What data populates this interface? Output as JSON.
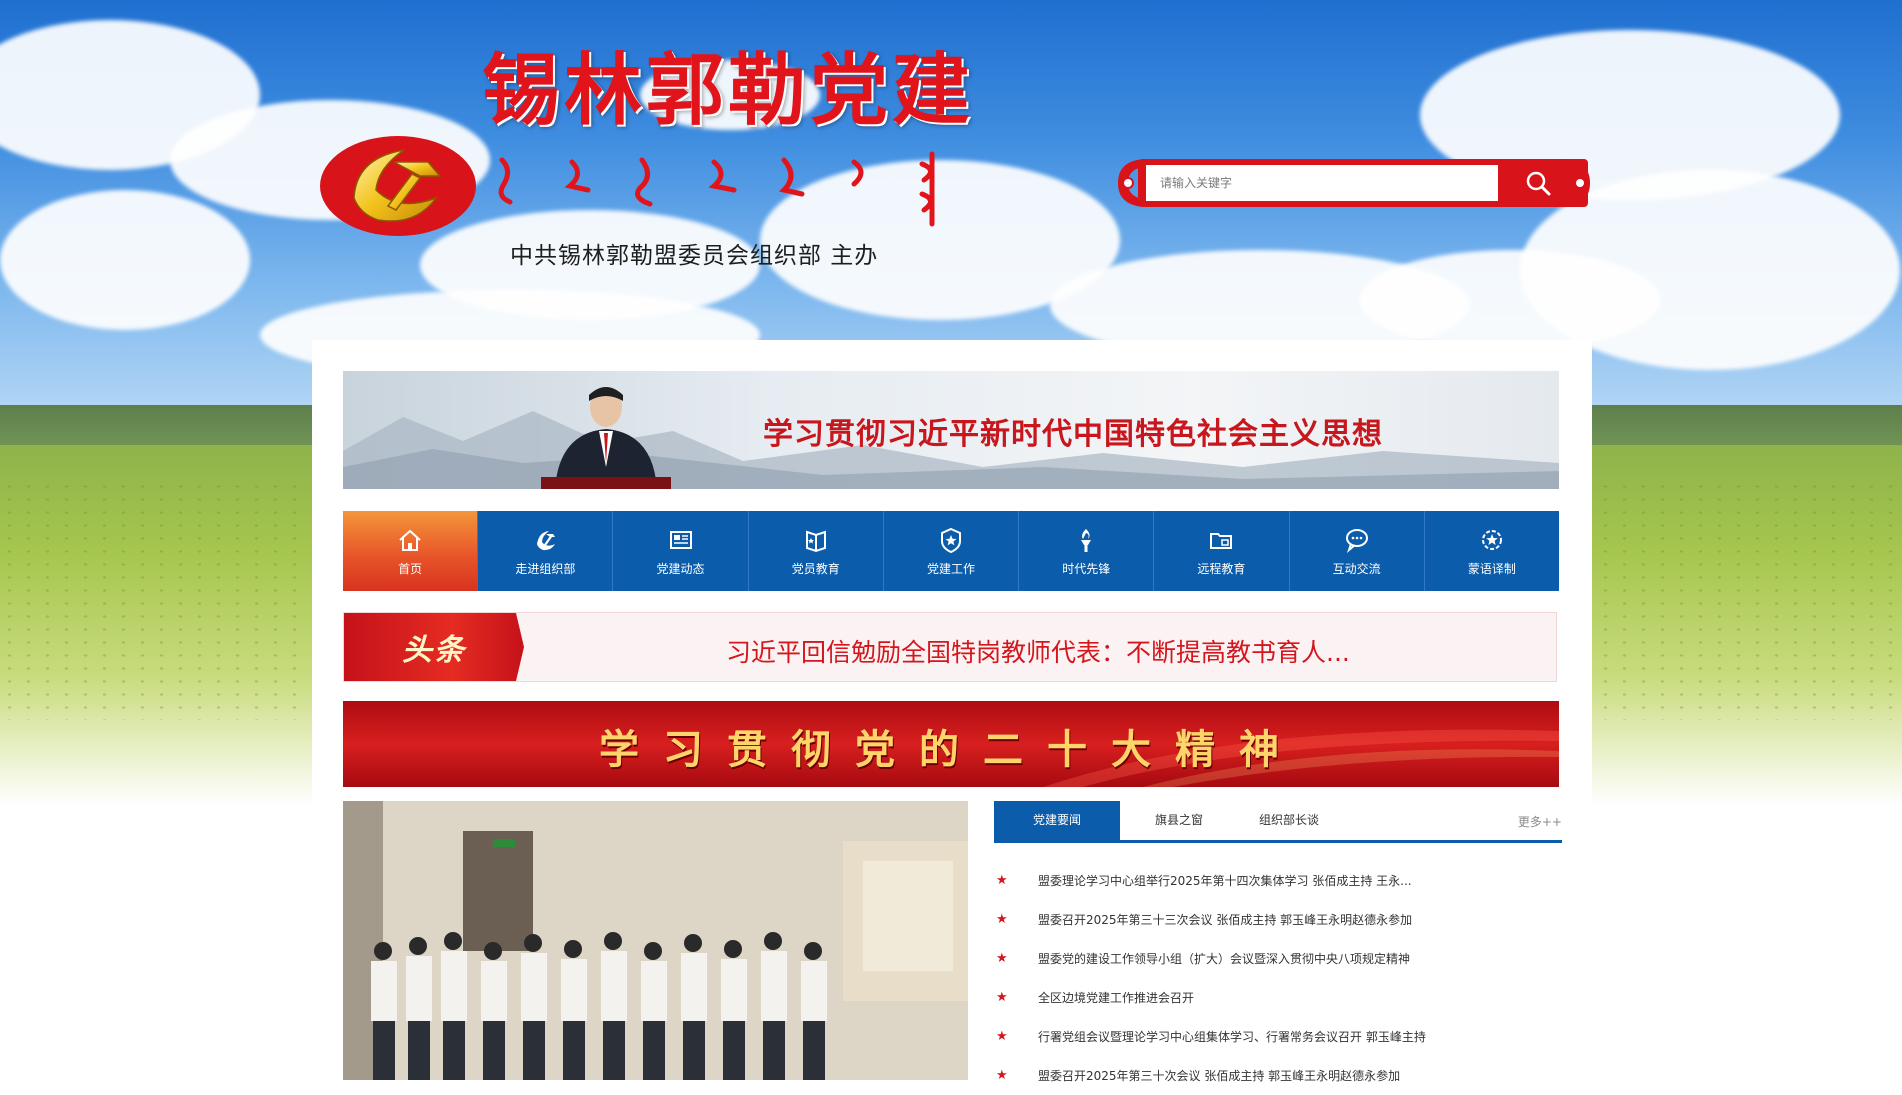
{
  "header": {
    "site_title": "锡林郭勒党建",
    "sponsor": "中共锡林郭勒盟委员会组织部 主办",
    "mongolian_script_label": "Mongolian script title"
  },
  "search": {
    "placeholder": "请输入关键字",
    "button_icon": "search-icon"
  },
  "banner": {
    "text": "学习贯彻习近平新时代中国特色社会主义思想"
  },
  "nav": {
    "items": [
      {
        "label": "首页",
        "icon": "home-icon"
      },
      {
        "label": "走进组织部",
        "icon": "party-emblem-icon"
      },
      {
        "label": "党建动态",
        "icon": "news-icon"
      },
      {
        "label": "党员教育",
        "icon": "book-icon"
      },
      {
        "label": "党建工作",
        "icon": "badge-star-icon"
      },
      {
        "label": "时代先锋",
        "icon": "torch-icon"
      },
      {
        "label": "远程教育",
        "icon": "folder-icon"
      },
      {
        "label": "互动交流",
        "icon": "chat-icon"
      },
      {
        "label": "蒙语译制",
        "icon": "gear-star-icon"
      }
    ]
  },
  "headline": {
    "tag": "头条",
    "text": "习近平回信勉励全国特岗教师代表：不断提高教书育人..."
  },
  "red_banner": {
    "text": "学习贯彻党的二十大精神"
  },
  "news": {
    "tabs": [
      "党建要闻",
      "旗县之窗",
      "组织部长谈"
    ],
    "more": "更多++",
    "items": [
      "盟委理论学习中心组举行2025年第十四次集体学习 张佰成主持 王永...",
      "盟委召开2025年第三十三次会议 张佰成主持 郭玉峰王永明赵德永参加",
      "盟委党的建设工作领导小组（扩大）会议暨深入贯彻中央八项规定精神",
      "全区边境党建工作推进会召开",
      "行署党组会议暨理论学习中心组集体学习、行署常务会议召开 郭玉峰主持",
      "盟委召开2025年第三十次会议 张佰成主持 郭玉峰王永明赵德永参加"
    ]
  },
  "colors": {
    "brand_red": "#d9131a",
    "nav_blue": "#0b5cab",
    "nav_active": "#e8572a",
    "sky_blue": "#3f8de0"
  }
}
